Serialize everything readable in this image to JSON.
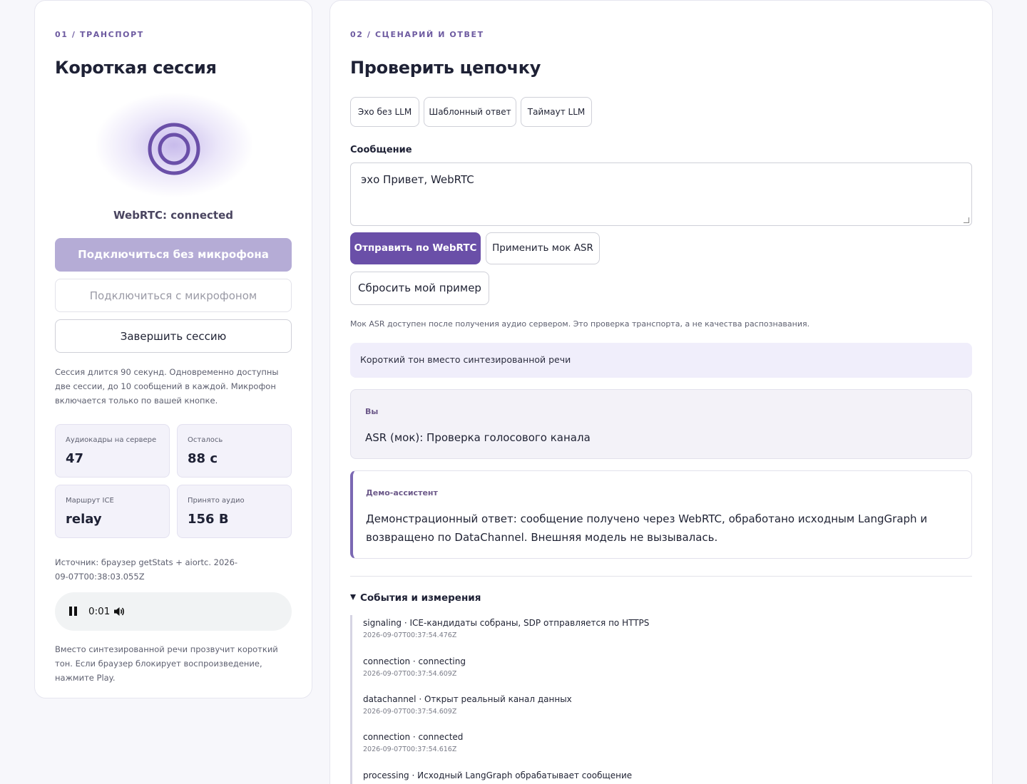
{
  "transport": {
    "kicker": "01 / ТРАНСПОРТ",
    "title": "Короткая сессия",
    "status": "WebRTC: connected",
    "btn_connect_no_mic": "Подключиться без микрофона",
    "btn_connect_mic": "Подключиться с микрофоном",
    "btn_end": "Завершить сессию",
    "note": "Сессия длится 90 секунд. Одновременно доступны две сессии, до 10 сообщений в каждой. Микрофон включается только по вашей кнопке.",
    "stats": [
      {
        "label": "Аудиокадры на сервере",
        "value": "47"
      },
      {
        "label": "Осталось",
        "value": "88 с"
      },
      {
        "label": "Маршрут ICE",
        "value": "relay"
      },
      {
        "label": "Принято аудио",
        "value": "156 B"
      }
    ],
    "source": "Источник: браузер getStats + aiortc. 2026-09-07T00:38:03.055Z",
    "audio_time": "0:01",
    "tone_note": "Вместо синтезированной речи прозвучит короткий тон. Если браузер блокирует воспроизведение, нажмите Play."
  },
  "scenario": {
    "kicker": "02 / СЦЕНАРИЙ И ОТВЕТ",
    "title": "Проверить цепочку",
    "chips": [
      "Эхо без LLM",
      "Шаблонный ответ",
      "Таймаут LLM"
    ],
    "message_label": "Сообщение",
    "message_value": "эхо Привет, WebRTC",
    "btn_send": "Отправить по WebRTC",
    "btn_mock_asr": "Применить мок ASR",
    "btn_reset": "Сбросить мой пример",
    "asr_note": "Мок ASR доступен после получения аудио сервером. Это проверка транспорта, а не качества распознавания.",
    "tone_banner": "Короткий тон вместо синтезированной речи",
    "user_msg": {
      "who": "Вы",
      "text": "ASR (мок): Проверка голосового канала"
    },
    "bot_msg": {
      "who": "Демо-ассистент",
      "text": "Демонстрационный ответ: сообщение получено через WebRTC, обработано исходным LangGraph и возвращено по DataChannel. Внешняя модель не вызывалась."
    },
    "events_title": "События и измерения",
    "events": [
      {
        "text": "signaling · ICE-кандидаты собраны, SDP отправляется по HTTPS",
        "ts": "2026-09-07T00:37:54.476Z"
      },
      {
        "text": "connection · connecting",
        "ts": "2026-09-07T00:37:54.609Z"
      },
      {
        "text": "datachannel · Открыт реальный канал данных",
        "ts": "2026-09-07T00:37:54.609Z"
      },
      {
        "text": "connection · connected",
        "ts": "2026-09-07T00:37:54.616Z"
      },
      {
        "text": "processing · Исходный LangGraph обрабатывает сообщение",
        "ts": ""
      }
    ]
  },
  "colors": {
    "accent": "#6a4fa8",
    "accent_disabled": "#b5acd6",
    "banner": "#f0eefb",
    "background": "#f7f7fb"
  }
}
